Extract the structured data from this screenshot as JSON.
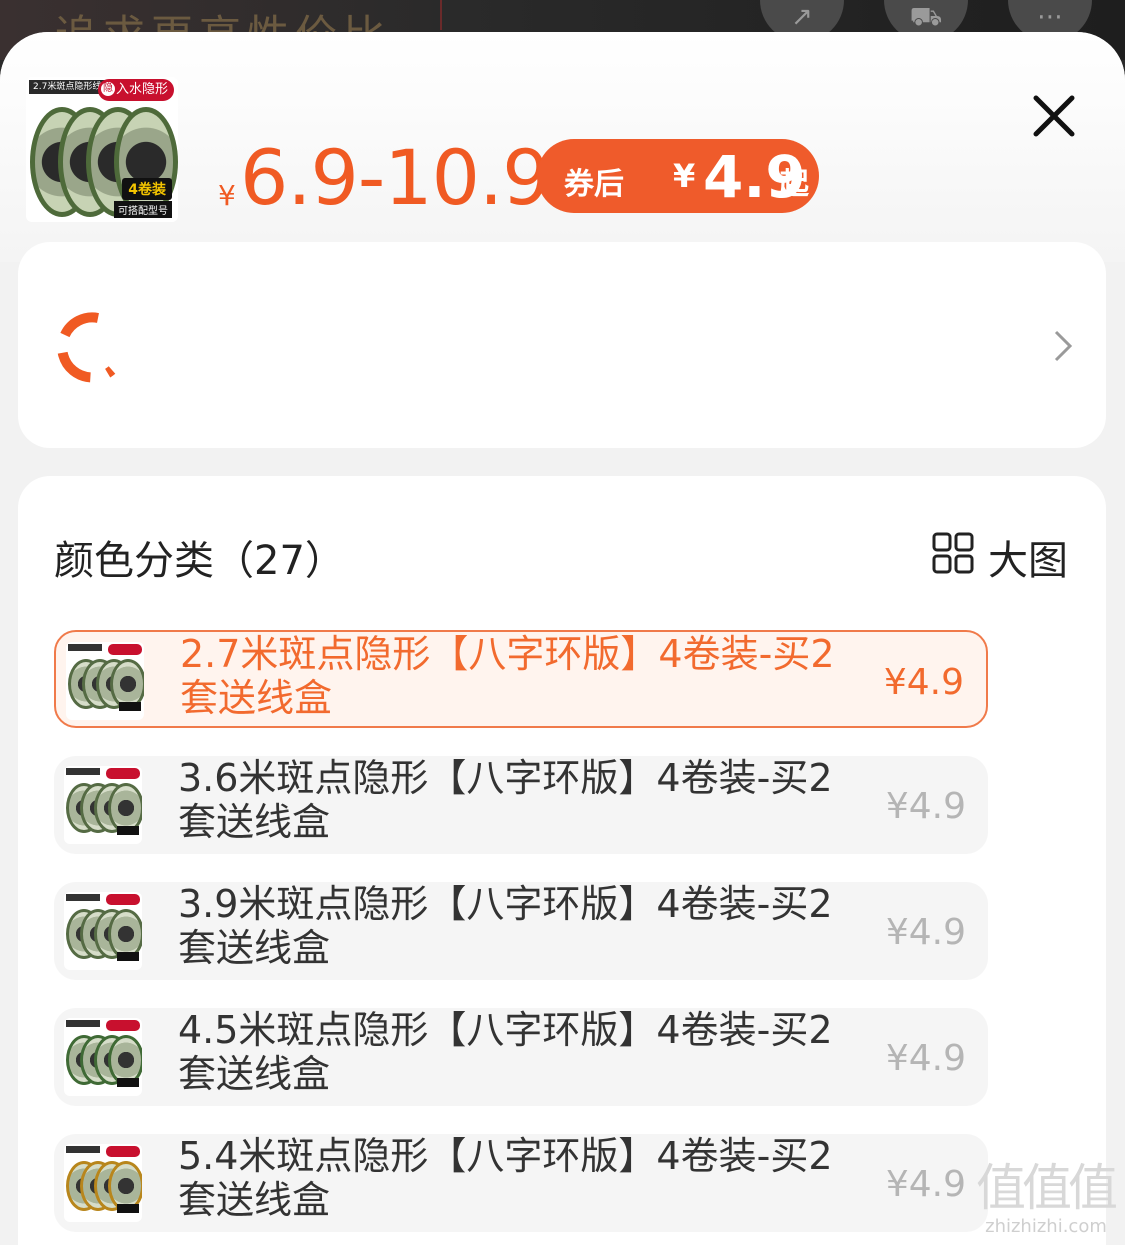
{
  "background": {
    "headline": "追求更高性价比",
    "icons": [
      "share-icon",
      "cart-icon",
      "more-icon"
    ]
  },
  "header": {
    "thumbnail": {
      "top_label": "2.7米斑点隐形线组",
      "tag": "入水隐形",
      "tag_icon_char": "隐",
      "badge": "4卷装",
      "sub_badge": "可搭配型号"
    },
    "price_symbol": "¥",
    "price_range": "6.9-10.9",
    "coupon": {
      "prefix": "券后",
      "symbol": "¥",
      "amount": "4.9",
      "suffix": "起"
    }
  },
  "address_card": {
    "text": ""
  },
  "sku": {
    "title": "颜色分类（27）",
    "view_toggle_label": "大图",
    "options": [
      {
        "name": "2.7米斑点隐形【八字环版】4卷装-买2套送线盒",
        "price": "¥4.9",
        "selected": true
      },
      {
        "name": "3.6米斑点隐形【八字环版】4卷装-买2套送线盒",
        "price": "¥4.9",
        "selected": false
      },
      {
        "name": "3.9米斑点隐形【八字环版】4卷装-买2套送线盒",
        "price": "¥4.9",
        "selected": false
      },
      {
        "name": "4.5米斑点隐形【八字环版】4卷装-买2套送线盒",
        "price": "¥4.9",
        "selected": false
      },
      {
        "name": "5.4米斑点隐形【八字环版】4卷装-买2套送线盒",
        "price": "¥4.9",
        "selected": false
      }
    ]
  },
  "watermark": {
    "logo": "值值值",
    "domain": "zhizhizhi.com"
  },
  "colors": {
    "accent": "#f05a23",
    "coupon_bg": "#ef5b2b",
    "selected_border": "#f07a4a",
    "muted_price": "#b5b5b5"
  }
}
